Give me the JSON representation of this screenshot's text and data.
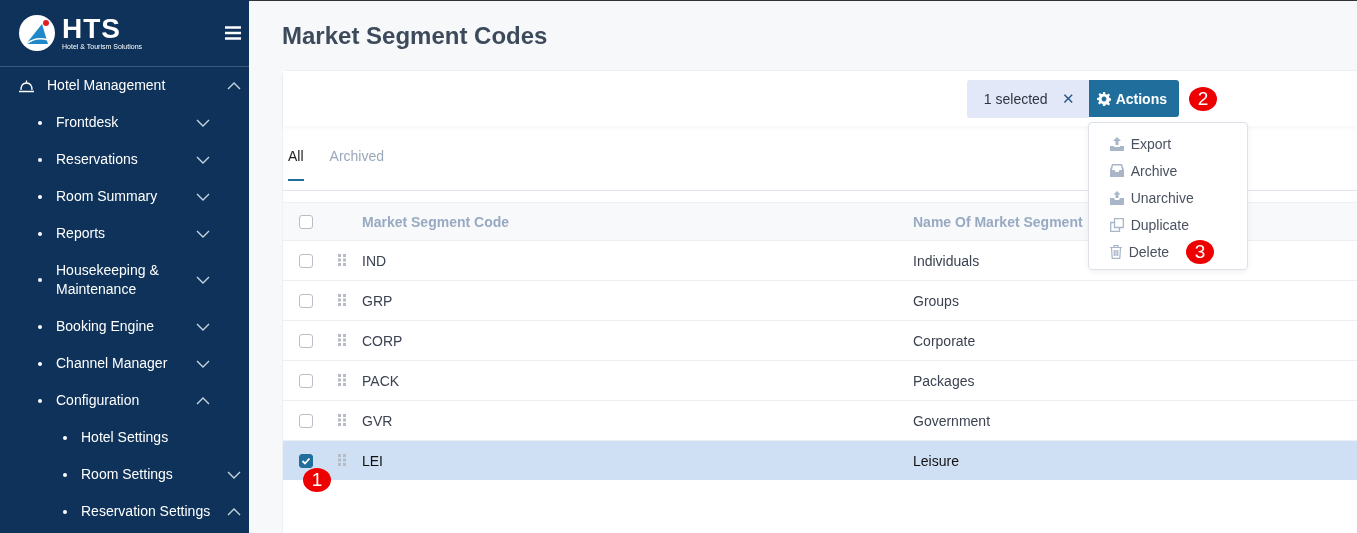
{
  "brand": {
    "name": "HTS",
    "tagline": "Hotel & Tourism Solutions"
  },
  "sidebar": {
    "items": [
      {
        "label": "Hotel Management",
        "expanded": true,
        "children": [
          {
            "label": "Frontdesk",
            "expanded": false
          },
          {
            "label": "Reservations",
            "expanded": false
          },
          {
            "label": "Room Summary",
            "expanded": false
          },
          {
            "label": "Reports",
            "expanded": false
          },
          {
            "label": "Housekeeping & Maintenance",
            "expanded": false
          },
          {
            "label": "Booking Engine",
            "expanded": false
          },
          {
            "label": "Channel Manager",
            "expanded": false
          },
          {
            "label": "Configuration",
            "expanded": true,
            "children": [
              {
                "label": "Hotel Settings"
              },
              {
                "label": "Room Settings",
                "expanded": false
              },
              {
                "label": "Reservation Settings",
                "expanded": true
              }
            ]
          }
        ]
      }
    ]
  },
  "page": {
    "title": "Market Segment Codes"
  },
  "toolbar": {
    "selection": "1 selected",
    "clear": "✕",
    "actions": {
      "label": "Actions",
      "marker": "2",
      "menu": [
        {
          "label": "Export",
          "kind": "export"
        },
        {
          "label": "Archive",
          "kind": "archive"
        },
        {
          "label": "Unarchive",
          "kind": "unarchive"
        },
        {
          "label": "Duplicate",
          "kind": "duplicate"
        },
        {
          "label": "Delete",
          "kind": "delete",
          "marker": "3"
        }
      ]
    }
  },
  "tabs": [
    {
      "label": "All",
      "selected": true
    },
    {
      "label": "Archived",
      "selected": false
    }
  ],
  "table": {
    "all_checked": false,
    "columns": [
      "Market Segment Code",
      "Name Of Market Segment"
    ],
    "rows": [
      {
        "cells": [
          "IND",
          "Individuals"
        ],
        "selected": false
      },
      {
        "cells": [
          "GRP",
          "Groups"
        ],
        "selected": false
      },
      {
        "cells": [
          "CORP",
          "Corporate"
        ],
        "selected": false
      },
      {
        "cells": [
          "PACK",
          "Packages"
        ],
        "selected": false
      },
      {
        "cells": [
          "GVR",
          "Government"
        ],
        "selected": false
      },
      {
        "cells": [
          "LEI",
          "Leisure"
        ],
        "selected": true,
        "marker": "1"
      }
    ]
  }
}
